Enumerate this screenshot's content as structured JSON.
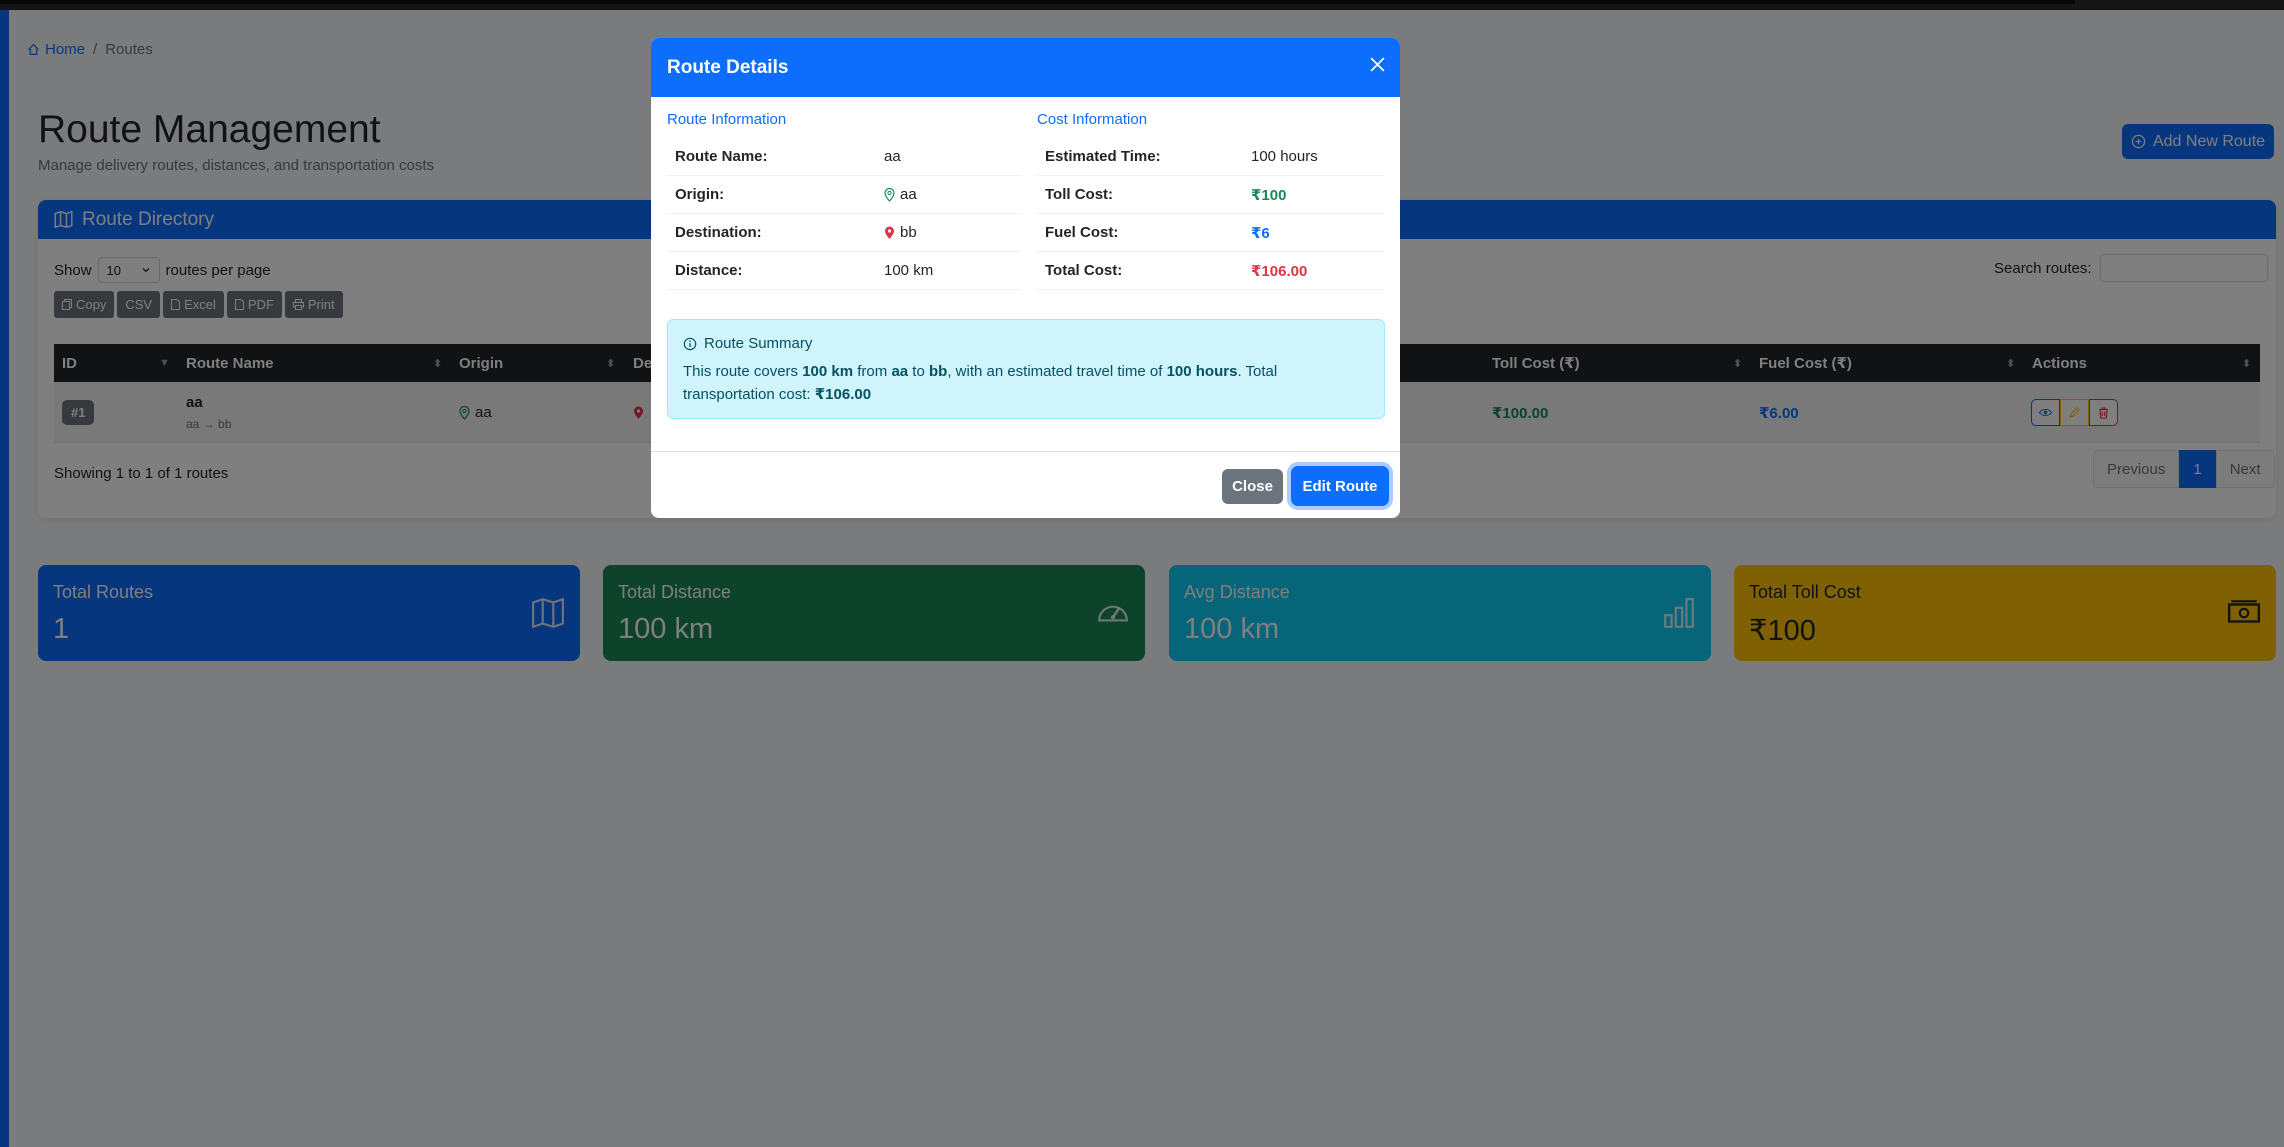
{
  "breadcrumb": {
    "home": "Home",
    "separator": "/",
    "current": "Routes"
  },
  "page": {
    "title": "Route Management",
    "subtitle": "Manage delivery routes, distances, and transportation costs",
    "add_button": "Add New Route"
  },
  "directory": {
    "title": "Route Directory",
    "show_label": "Show",
    "page_size": "10",
    "per_page_label": "routes per page",
    "search_label": "Search routes:",
    "search_value": "",
    "export_buttons": [
      "Copy",
      "CSV",
      "Excel",
      "PDF",
      "Print"
    ],
    "columns": [
      "ID",
      "Route Name",
      "Origin",
      "De",
      "Toll Cost (₹)",
      "Fuel Cost (₹)",
      "Actions"
    ],
    "row": {
      "id": "#1",
      "name": "aa",
      "path": "aa → bb",
      "origin": "aa",
      "toll": "₹100.00",
      "fuel": "₹6.00"
    },
    "showing": "Showing 1 to 1 of 1 routes",
    "pager": {
      "previous": "Previous",
      "current": "1",
      "next": "Next"
    }
  },
  "stats": [
    {
      "label": "Total Routes",
      "value": "1",
      "icon": "map-icon",
      "color": "#0d6efd"
    },
    {
      "label": "Total Distance",
      "value": "100 km",
      "icon": "speedometer-icon",
      "color": "#198754"
    },
    {
      "label": "Avg Distance",
      "value": "100 km",
      "icon": "bar-chart-icon",
      "color": "#0dcaf0"
    },
    {
      "label": "Total Toll Cost",
      "value": "₹100",
      "icon": "cash-icon",
      "color": "#ffc107"
    }
  ],
  "modal": {
    "title": "Route Details",
    "route_info": {
      "heading": "Route Information",
      "name_label": "Route Name:",
      "name": "aa",
      "origin_label": "Origin:",
      "origin": "aa",
      "destination_label": "Destination:",
      "destination": "bb",
      "distance_label": "Distance:",
      "distance": "100 km"
    },
    "cost_info": {
      "heading": "Cost Information",
      "time_label": "Estimated Time:",
      "time": "100 hours",
      "toll_label": "Toll Cost:",
      "toll": "₹100",
      "fuel_label": "Fuel Cost:",
      "fuel": "₹6",
      "total_label": "Total Cost:",
      "total": "₹106.00"
    },
    "summary": {
      "title": "Route Summary",
      "t1": "This route covers ",
      "distance": "100 km",
      "t2": " from ",
      "from": "aa",
      "t3": " to ",
      "to": "bb",
      "t4": ", with an estimated travel time of ",
      "time": "100 hours",
      "t5": ". Total transportation cost: ",
      "total": "₹106.00"
    },
    "close_button": "Close",
    "edit_button": "Edit Route"
  }
}
